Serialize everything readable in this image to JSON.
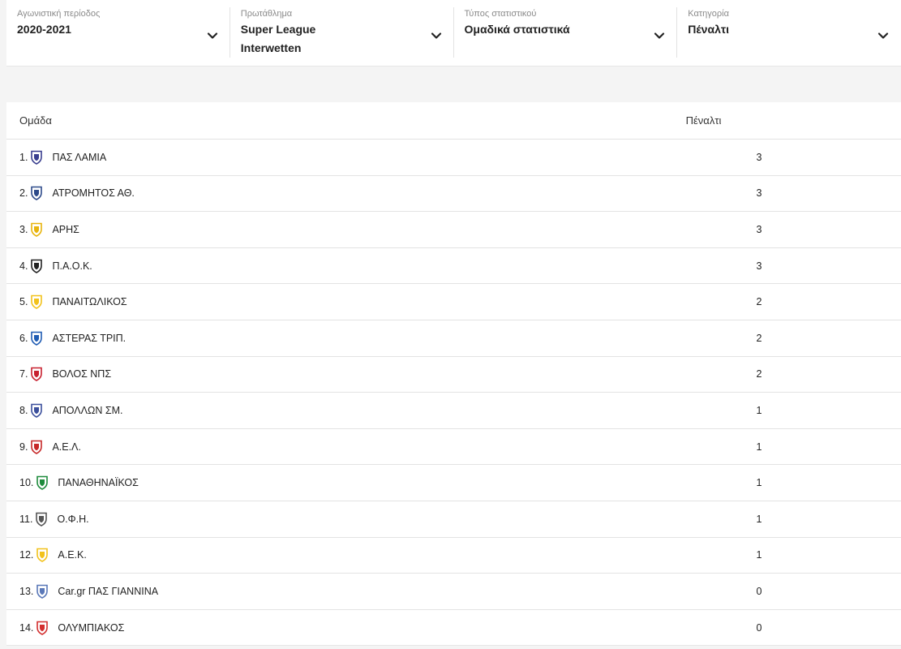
{
  "filters": [
    {
      "label": "Αγωνιστική περίοδος",
      "value": "2020-2021"
    },
    {
      "label": "Πρωτάθλημα",
      "value": "Super League Interwetten"
    },
    {
      "label": "Τύπος στατιστικού",
      "value": "Ομαδικά στατιστικά"
    },
    {
      "label": "Κατηγορία",
      "value": "Πέναλτι"
    }
  ],
  "table": {
    "headers": {
      "team": "Ομάδα",
      "value": "Πέναλτι"
    },
    "rows": [
      {
        "rank": "1.",
        "team": "ΠΑΣ ΛΑΜΙΑ",
        "value": "3",
        "crest": "lamia-crest-icon",
        "color": "#3a3f8f"
      },
      {
        "rank": "2.",
        "team": "ΑΤΡΟΜΗΤΟΣ ΑΘ.",
        "value": "3",
        "crest": "atromitos-crest-icon",
        "color": "#2d4a8a"
      },
      {
        "rank": "3.",
        "team": "ΑΡΗΣ",
        "value": "3",
        "crest": "aris-crest-icon",
        "color": "#e8b40c"
      },
      {
        "rank": "4.",
        "team": "Π.Α.Ο.Κ.",
        "value": "3",
        "crest": "paok-crest-icon",
        "color": "#222222"
      },
      {
        "rank": "5.",
        "team": "ΠΑΝΑΙΤΩΛΙΚΟΣ",
        "value": "2",
        "crest": "panaitolikos-crest-icon",
        "color": "#f2c21b"
      },
      {
        "rank": "6.",
        "team": "ΑΣΤΕΡΑΣ ΤΡΙΠ.",
        "value": "2",
        "crest": "asteras-crest-icon",
        "color": "#1f5cb3"
      },
      {
        "rank": "7.",
        "team": "ΒΟΛΟΣ ΝΠΣ",
        "value": "2",
        "crest": "volos-crest-icon",
        "color": "#c8202f"
      },
      {
        "rank": "8.",
        "team": "ΑΠΟΛΛΩΝ ΣΜ.",
        "value": "1",
        "crest": "apollon-crest-icon",
        "color": "#3b4f9c"
      },
      {
        "rank": "9.",
        "team": "Α.Ε.Λ.",
        "value": "1",
        "crest": "ael-crest-icon",
        "color": "#c62828"
      },
      {
        "rank": "10.",
        "team": "ΠΑΝΑΘΗΝΑΪΚΟΣ",
        "value": "1",
        "crest": "panathinaikos-crest-icon",
        "color": "#1e8b3c"
      },
      {
        "rank": "11.",
        "team": "Ο.Φ.Η.",
        "value": "1",
        "crest": "ofi-crest-icon",
        "color": "#555555"
      },
      {
        "rank": "12.",
        "team": "Α.Ε.Κ.",
        "value": "1",
        "crest": "aek-crest-icon",
        "color": "#f2c21b"
      },
      {
        "rank": "13.",
        "team": "Car.gr ΠΑΣ ΓΙΑΝΝΙΝΑ",
        "value": "0",
        "crest": "pas-giannina-crest-icon",
        "color": "#5a78b8"
      },
      {
        "rank": "14.",
        "team": "ΟΛΥΜΠΙΑΚΟΣ",
        "value": "0",
        "crest": "olympiacos-crest-icon",
        "color": "#d32f2f"
      }
    ]
  }
}
